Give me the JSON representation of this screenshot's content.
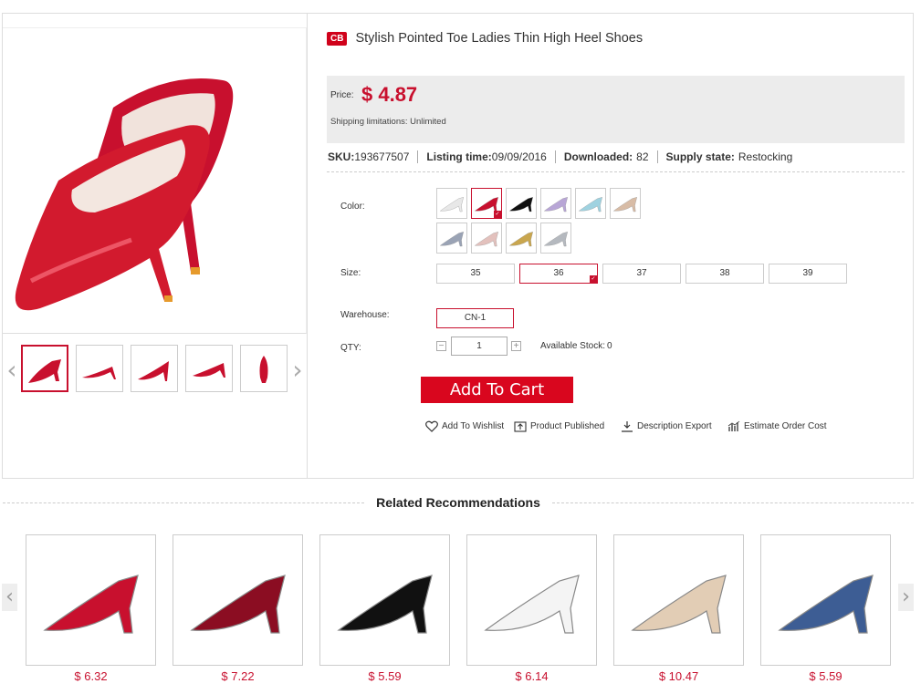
{
  "product": {
    "badge": "CB",
    "title": "Stylish Pointed Toe Ladies Thin High Heel Shoes",
    "price_label": "Price:",
    "price": "$ 4.87",
    "shipping": "Shipping limitations: Unlimited"
  },
  "meta": {
    "sku_label": "SKU:",
    "sku": "193677507",
    "listing_label": "Listing time:",
    "listing": "09/09/2016",
    "downloaded_label": "Downloaded:",
    "downloaded": "82",
    "supply_label": "Supply state:",
    "supply": "Restocking"
  },
  "options": {
    "color_label": "Color:",
    "color_swatches": [
      {
        "name": "white",
        "hex": "#e8e8e8"
      },
      {
        "name": "red",
        "hex": "#c8102e",
        "selected": true
      },
      {
        "name": "black",
        "hex": "#111111"
      },
      {
        "name": "lilac",
        "hex": "#b8a6d6"
      },
      {
        "name": "light-blue",
        "hex": "#9fd2e0"
      },
      {
        "name": "nude",
        "hex": "#d8bca6"
      },
      {
        "name": "grey-blue",
        "hex": "#9aa3b5"
      },
      {
        "name": "pink-beige",
        "hex": "#e3c1bd"
      },
      {
        "name": "gold",
        "hex": "#c9a64e"
      },
      {
        "name": "silver",
        "hex": "#b5b9bf"
      }
    ],
    "size_label": "Size:",
    "sizes": [
      "35",
      "36",
      "37",
      "38",
      "39"
    ],
    "selected_size": "36",
    "warehouse_label": "Warehouse:",
    "warehouse": "CN-1",
    "qty_label": "QTY:",
    "qty": "1",
    "stock_label": "Available Stock:",
    "stock": "0"
  },
  "actions": {
    "add_to_cart": "Add To Cart",
    "wishlist": "Add To Wishlist",
    "published": "Product Published",
    "export": "Description Export",
    "estimate": "Estimate Order Cost"
  },
  "related": {
    "title": "Related Recommendations",
    "items": [
      {
        "price": "$ 6.32",
        "color": "#c8102e",
        "style": "pump-gradient"
      },
      {
        "price": "$ 7.22",
        "color": "#8b0d22",
        "style": "platform-suede"
      },
      {
        "price": "$ 5.59",
        "color": "#111111",
        "style": "platform-patent"
      },
      {
        "price": "$ 6.14",
        "color": "#f4f4f4",
        "style": "pump-white"
      },
      {
        "price": "$ 10.47",
        "color": "#e2cdb5",
        "style": "fur-sandal"
      },
      {
        "price": "$ 5.59",
        "color": "#3d5d94",
        "style": "denim-sandal"
      }
    ]
  },
  "icons": {
    "prev": "chevron-left-icon",
    "next": "chevron-right-icon",
    "wishlist": "heart-icon",
    "published": "upload-icon",
    "export": "download-icon",
    "estimate": "chart-icon"
  }
}
